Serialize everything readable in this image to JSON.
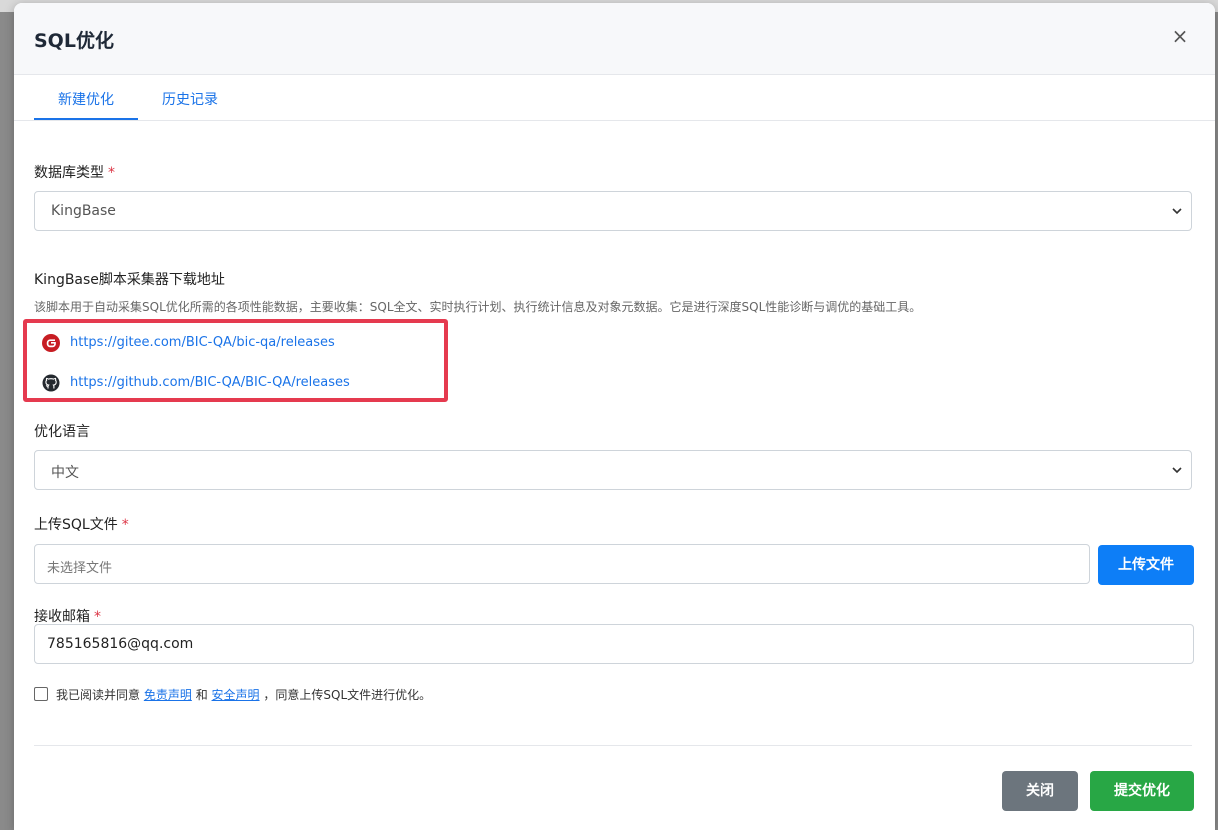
{
  "modal": {
    "title": "SQL优化",
    "close_glyph": "×"
  },
  "tabs": [
    {
      "label": "新建优化",
      "active": true
    },
    {
      "label": "历史记录",
      "active": false
    }
  ],
  "db_type": {
    "label": "数据库类型",
    "required_mark": "*",
    "selected": "KingBase"
  },
  "collector": {
    "title": "KingBase脚本采集器下载地址",
    "description": "该脚本用于自动采集SQL优化所需的各项性能数据，主要收集：SQL全文、实时执行计划、执行统计信息及对象元数据。它是进行深度SQL性能诊断与调优的基础工具。",
    "links": [
      {
        "icon": "gitee-icon",
        "url": "https://gitee.com/BIC-QA/bic-qa/releases"
      },
      {
        "icon": "github-icon",
        "url": "https://github.com/BIC-QA/BIC-QA/releases"
      }
    ]
  },
  "language": {
    "label": "优化语言",
    "selected": "中文"
  },
  "upload": {
    "label": "上传SQL文件",
    "required_mark": "*",
    "placeholder": "未选择文件",
    "button_label": "上传文件"
  },
  "email": {
    "label": "接收邮箱",
    "required_mark": "*",
    "value": "785165816@qq.com"
  },
  "agreement": {
    "prefix": "我已阅读并同意",
    "link1": "免责声明",
    "and": "和",
    "link2": "安全声明",
    "suffix": "，同意上传SQL文件进行优化。"
  },
  "footer": {
    "close_label": "关闭",
    "submit_label": "提交优化"
  },
  "colors": {
    "primary": "#0d7ef7",
    "success": "#28a745",
    "secondary": "#6c757d",
    "highlight": "#e53a4f",
    "required": "#dc3545"
  }
}
